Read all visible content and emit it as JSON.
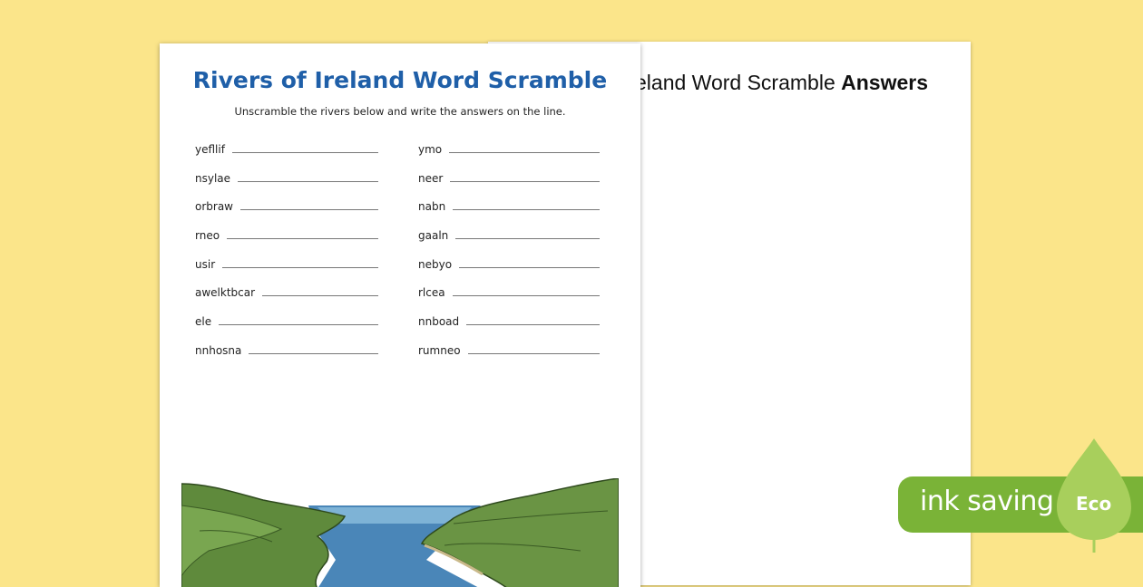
{
  "answers_sheet": {
    "title_partial": "eland Word Scramble ",
    "title_bold": "Answers"
  },
  "worksheet": {
    "title": "Rivers of Ireland Word Scramble",
    "instructions": "Unscramble the rivers below and write the answers on the line.",
    "left_words": [
      "yefllif",
      "nsylae",
      "orbraw",
      "rneo",
      "usir",
      "awelktbcar",
      "ele",
      "nnhosna"
    ],
    "right_words": [
      "ymo",
      "neer",
      "nabn",
      "gaaln",
      "nebyo",
      "rlcea",
      "nnboad",
      "rumneo"
    ]
  },
  "badge": {
    "text": "ink saving",
    "leaf_label": "Eco"
  },
  "colors": {
    "background": "#fbe58a",
    "title_blue": "#1f5fa8",
    "badge_green": "#7ab337",
    "leaf_green": "#a8cf5c"
  }
}
